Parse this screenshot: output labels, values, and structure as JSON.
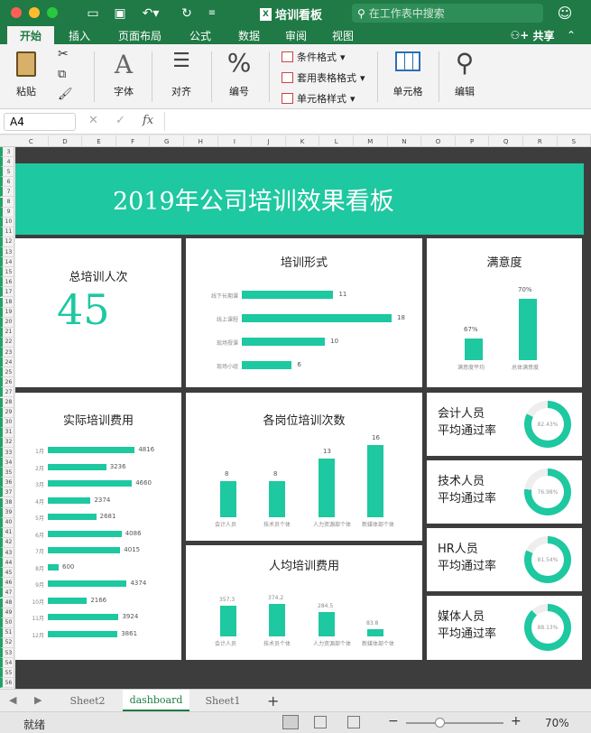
{
  "app": {
    "document_title": "培训看板",
    "search_placeholder": "在工作表中搜索",
    "share_label": "共享"
  },
  "ribbon_tabs": [
    "开始",
    "插入",
    "页面布局",
    "公式",
    "数据",
    "审阅",
    "视图"
  ],
  "ribbon": {
    "paste": "粘贴",
    "font": "字体",
    "align": "对齐",
    "number": "编号",
    "cond_format": "条件格式",
    "table_format": "套用表格格式",
    "cell_style": "单元格样式",
    "cells": "单元格",
    "edit": "编辑"
  },
  "formula_bar": {
    "name_box": "A4",
    "fx": "fx",
    "formula": ""
  },
  "columns": [
    "C",
    "D",
    "E",
    "F",
    "G",
    "H",
    "I",
    "J",
    "K",
    "L",
    "M",
    "N",
    "O",
    "P",
    "Q",
    "R",
    "S"
  ],
  "dashboard": {
    "title": "2019年公司培训效果看板",
    "total_label": "总培训人次",
    "total_value": "45",
    "form_title": "培训形式",
    "satisfaction_title": "满意度",
    "cost_title": "实际培训费用",
    "position_title": "各岗位培训次数",
    "avg_cost_title": "人均培训费用",
    "pass_cards": [
      {
        "line1": "会计人员",
        "line2": "平均通过率",
        "value": "82.43%",
        "pct": 0.8243
      },
      {
        "line1": "技术人员",
        "line2": "平均通过率",
        "value": "76.98%",
        "pct": 0.7698
      },
      {
        "line1": "HR人员",
        "line2": "平均通过率",
        "value": "81.54%",
        "pct": 0.8154
      },
      {
        "line1": "媒体人员",
        "line2": "平均通过率",
        "value": "88.13%",
        "pct": 0.8813
      }
    ]
  },
  "chart_data": [
    {
      "type": "bar",
      "orientation": "horizontal",
      "title": "培训形式",
      "categories": [
        "线下长期课",
        "线上课程",
        "现场授课",
        "现场小组"
      ],
      "values": [
        11,
        18,
        10,
        6
      ]
    },
    {
      "type": "bar",
      "title": "满意度",
      "categories": [
        "满意度平均",
        "总体满意度"
      ],
      "values": [
        67,
        70
      ],
      "value_labels": [
        "67%",
        "70%"
      ]
    },
    {
      "type": "bar",
      "orientation": "horizontal",
      "title": "实际培训费用",
      "categories": [
        "1月",
        "2月",
        "3月",
        "4月",
        "5月",
        "6月",
        "7月",
        "8月",
        "9月",
        "10月",
        "11月",
        "12月"
      ],
      "values": [
        4816,
        3236,
        4660,
        2374,
        2681,
        4086,
        4015,
        600,
        4374,
        2166,
        3924,
        3861
      ]
    },
    {
      "type": "bar",
      "title": "各岗位培训次数",
      "categories": [
        "会计人员",
        "技术员个体",
        "人力资源部个体",
        "新媒体部个体"
      ],
      "values": [
        8,
        8,
        13,
        16
      ]
    },
    {
      "type": "bar",
      "title": "人均培训费用",
      "categories": [
        "会计人员",
        "技术员个体",
        "人力资源部个体",
        "新媒体部个体"
      ],
      "values": [
        357.3,
        374.2,
        284.5,
        83.8
      ],
      "value_labels": [
        "357.3",
        "374.2",
        "284.5",
        "83.8"
      ]
    }
  ],
  "sheet_tabs": [
    "Sheet2",
    "dashboard",
    "Sheet1"
  ],
  "status": {
    "ready": "就绪",
    "zoom": "70%"
  },
  "colors": {
    "accent": "#1ec8a0",
    "excel_green": "#1f7a45",
    "sheet_bg": "#3d3d3d"
  }
}
